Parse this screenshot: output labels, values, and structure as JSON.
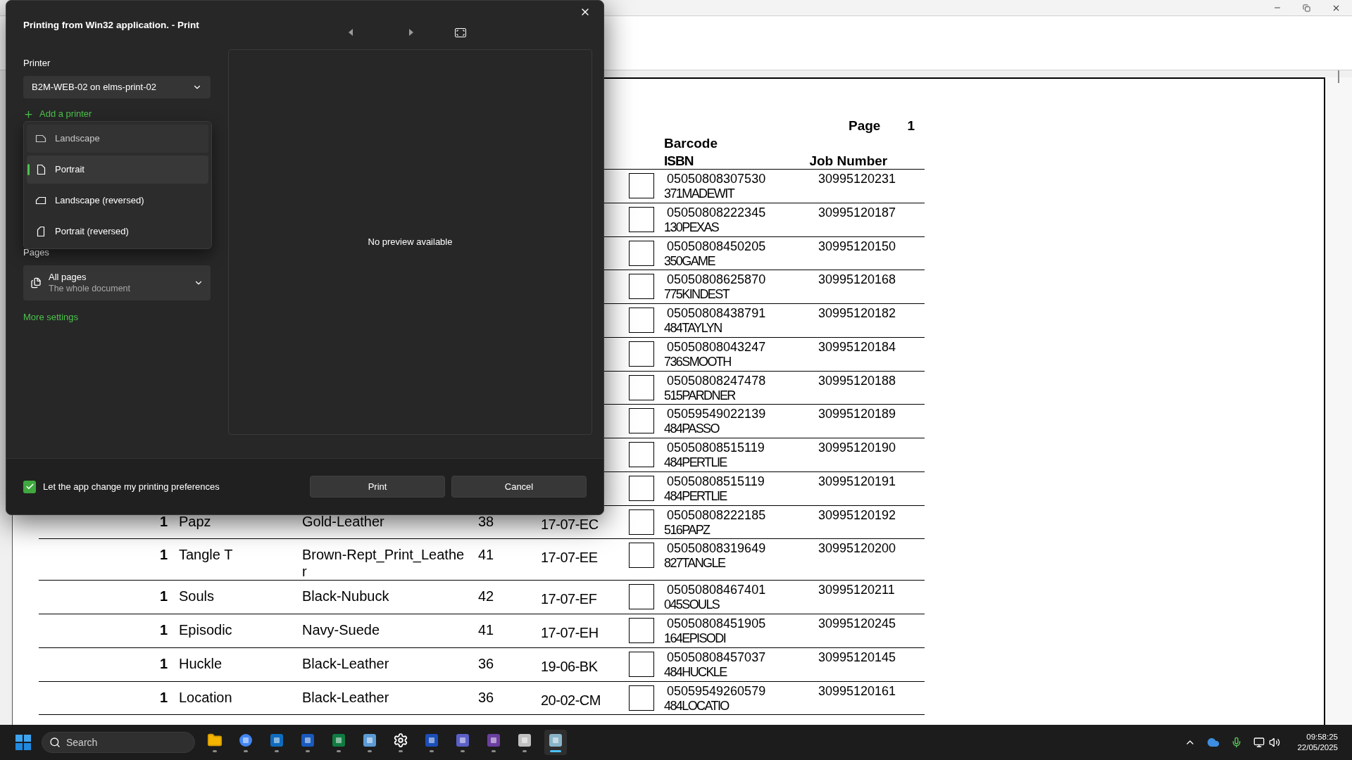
{
  "document": {
    "page_label": "Page",
    "page_number": "1",
    "headers": {
      "barcode": "Barcode",
      "isbn": "ISBN",
      "job": "Job Number"
    },
    "rows": [
      {
        "isbn": "05050808307530",
        "isbn_suffix": "371MADEWIT",
        "job": "30995120231",
        "checked": false
      },
      {
        "isbn": "05050808222345",
        "isbn_suffix": "130PEXAS",
        "job": "30995120187",
        "checked": false
      },
      {
        "isbn": "05050808450205",
        "isbn_suffix": "350GAME",
        "job": "30995120150",
        "checked": false
      },
      {
        "isbn": "05050808625870",
        "isbn_suffix": "775KINDEST",
        "job": "30995120168",
        "checked": false
      },
      {
        "isbn": "05050808438791",
        "isbn_suffix": "484TAYLYN",
        "job": "30995120182",
        "checked": false
      },
      {
        "isbn": "05050808043247",
        "isbn_suffix": "736SMOOTH",
        "job": "30995120184",
        "checked": false
      },
      {
        "isbn": "05050808247478",
        "isbn_suffix": "515PARDNER",
        "job": "30995120188",
        "checked": false
      },
      {
        "isbn": "05059549022139",
        "isbn_suffix": "484PASSO",
        "job": "30995120189",
        "checked": false
      },
      {
        "isbn": "05050808515119",
        "isbn_suffix": "484PERTLIE",
        "job": "30995120190",
        "checked": false
      },
      {
        "isbn": "05050808515119",
        "isbn_suffix": "484PERTLIE",
        "job": "30995120191",
        "checked": false
      },
      {
        "qty": "1",
        "name": "Papz",
        "colour": "Gold-Leather",
        "size": "38",
        "code": "17-07-EC",
        "isbn": "05050808222185",
        "isbn_suffix": "516PAPZ",
        "job": "30995120192",
        "checked": false
      },
      {
        "qty": "1",
        "name": "Tangle T",
        "colour": "Brown-Rept_Print_Leather",
        "size": "41",
        "code": "17-07-EE",
        "isbn": "05050808319649",
        "isbn_suffix": "827TANGLE",
        "job": "30995120200",
        "checked": false
      },
      {
        "qty": "1",
        "name": "Souls",
        "colour": "Black-Nubuck",
        "size": "42",
        "code": "17-07-EF",
        "isbn": "05050808467401",
        "isbn_suffix": "045SOULS",
        "job": "30995120211",
        "checked": false
      },
      {
        "qty": "1",
        "name": "Episodic",
        "colour": "Navy-Suede",
        "size": "41",
        "code": "17-07-EH",
        "isbn": "05050808451905",
        "isbn_suffix": "164EPISODI",
        "job": "30995120245",
        "checked": false
      },
      {
        "qty": "1",
        "name": "Huckle",
        "colour": "Black-Leather",
        "size": "36",
        "code": "19-06-BK",
        "isbn": "05050808457037",
        "isbn_suffix": "484HUCKLE",
        "job": "30995120145",
        "checked": false
      },
      {
        "qty": "1",
        "name": "Location",
        "colour": "Black-Leather",
        "size": "36",
        "code": "20-02-CM",
        "isbn": "05059549260579",
        "isbn_suffix": "484LOCATIO",
        "job": "30995120161",
        "checked": false
      }
    ]
  },
  "dialog": {
    "title": "Printing from Win32 application. - Print",
    "printer_label": "Printer",
    "printer": "B2M-WEB-02 on elms-print-02",
    "add_printer": "Add a printer",
    "orientation_menu": [
      {
        "label": "Landscape",
        "kind": "landscape",
        "selected": false,
        "hovered": true
      },
      {
        "label": "Portrait",
        "kind": "portrait",
        "selected": true,
        "hovered": false
      },
      {
        "label": "Landscape (reversed)",
        "kind": "landscape-reversed",
        "selected": false,
        "hovered": false
      },
      {
        "label": "Portrait (reversed)",
        "kind": "portrait-reversed",
        "selected": false,
        "hovered": false
      }
    ],
    "pages_label": "Pages",
    "pages": {
      "value": "All pages",
      "description": "The whole document"
    },
    "more_settings": "More settings",
    "preview_message": "No preview available",
    "preferences_checkbox": {
      "label": "Let the app change my printing preferences",
      "checked": true
    },
    "buttons": [
      "Print",
      "Cancel"
    ]
  },
  "taskbar": {
    "search_placeholder": "Search",
    "time": "09:58:25",
    "date": "22/05/2025"
  }
}
